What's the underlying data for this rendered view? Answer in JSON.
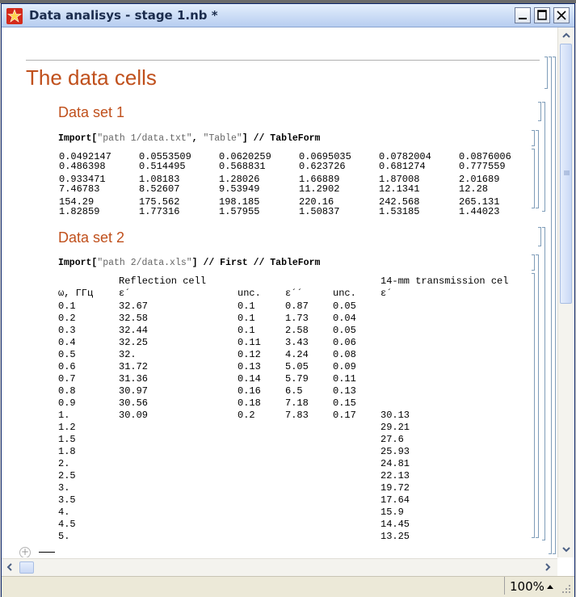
{
  "window": {
    "title": "Data analisys - stage 1.nb *",
    "zoom": "100%"
  },
  "notebook": {
    "section_title": "The data cells",
    "set1": {
      "title": "Data set 1",
      "input": {
        "fn": "Import",
        "arg1": "\"path 1/data.txt\"",
        "sep": ", ",
        "arg2": "\"Table\"",
        "post": "] // TableForm"
      },
      "rows": [
        [
          "0.0492147",
          "0.0553509",
          "0.0620259",
          "0.0695035",
          "0.0782004",
          "0.0876006"
        ],
        [
          "0.486398",
          "0.514495",
          "0.568831",
          "0.623726",
          "0.681274",
          "0.777559"
        ],
        [
          "0.933471",
          "1.08183",
          "1.28026",
          "1.66889",
          "1.87008",
          "2.01689"
        ],
        [
          "7.46783",
          "8.52607",
          "9.53949",
          "11.2902",
          "12.1341",
          "12.28"
        ],
        [
          "154.29",
          "175.562",
          "198.185",
          "220.16",
          "242.568",
          "265.131"
        ],
        [
          "1.82859",
          "1.77316",
          "1.57955",
          "1.50837",
          "1.53185",
          "1.44023"
        ]
      ]
    },
    "set2": {
      "title": "Data set 2",
      "input": {
        "fn": "Import",
        "arg1": "\"path 2/data.xls\"",
        "post": "] // First // TableForm"
      },
      "group_header_1": "Reflection cell",
      "group_header_2": "14-mm transmission cel",
      "headers": [
        "ω, ГГц",
        "ε´",
        "unc.",
        "ε´´",
        "unc.",
        "ε´"
      ],
      "rows": [
        [
          "0.1",
          "32.67",
          "0.1",
          "0.87",
          "0.05",
          ""
        ],
        [
          "0.2",
          "32.58",
          "0.1",
          "1.73",
          "0.04",
          ""
        ],
        [
          "0.3",
          "32.44",
          "0.1",
          "2.58",
          "0.05",
          ""
        ],
        [
          "0.4",
          "32.25",
          "0.11",
          "3.43",
          "0.06",
          ""
        ],
        [
          "0.5",
          "32.",
          "0.12",
          "4.24",
          "0.08",
          ""
        ],
        [
          "0.6",
          "31.72",
          "0.13",
          "5.05",
          "0.09",
          ""
        ],
        [
          "0.7",
          "31.36",
          "0.14",
          "5.79",
          "0.11",
          ""
        ],
        [
          "0.8",
          "30.97",
          "0.16",
          "6.5",
          "0.13",
          ""
        ],
        [
          "0.9",
          "30.56",
          "0.18",
          "7.18",
          "0.15",
          ""
        ],
        [
          "1.",
          "30.09",
          "0.2",
          "7.83",
          "0.17",
          "30.13"
        ],
        [
          "1.2",
          "",
          "",
          "",
          "",
          "29.21"
        ],
        [
          "1.5",
          "",
          "",
          "",
          "",
          "27.6"
        ],
        [
          "1.8",
          "",
          "",
          "",
          "",
          "25.93"
        ],
        [
          "2.",
          "",
          "",
          "",
          "",
          "24.81"
        ],
        [
          "2.5",
          "",
          "",
          "",
          "",
          "22.13"
        ],
        [
          "3.",
          "",
          "",
          "",
          "",
          "19.72"
        ],
        [
          "3.5",
          "",
          "",
          "",
          "",
          "17.64"
        ],
        [
          "4.",
          "",
          "",
          "",
          "",
          "15.9"
        ],
        [
          "4.5",
          "",
          "",
          "",
          "",
          "14.45"
        ],
        [
          "5.",
          "",
          "",
          "",
          "",
          "13.25"
        ]
      ]
    }
  },
  "colors": {
    "section": "#c0501c",
    "title_bar": "#b7cdf0"
  }
}
